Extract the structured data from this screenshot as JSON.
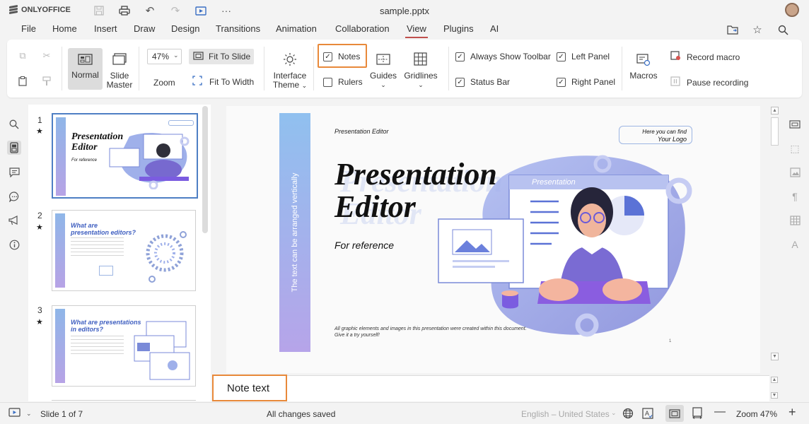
{
  "app": {
    "brand": "ONLYOFFICE",
    "file_title": "sample.pptx"
  },
  "menu": {
    "tabs": [
      "File",
      "Home",
      "Insert",
      "Draw",
      "Design",
      "Transitions",
      "Animation",
      "Collaboration",
      "View",
      "Plugins",
      "AI"
    ],
    "active": "View"
  },
  "toolbar": {
    "normal": "Normal",
    "slide_master_1": "Slide",
    "slide_master_2": "Master",
    "zoom_value": "47%",
    "zoom_label": "Zoom",
    "fit_to_slide": "Fit To Slide",
    "fit_to_width": "Fit To Width",
    "interface_theme_1": "Interface",
    "interface_theme_2": "Theme",
    "notes": "Notes",
    "rulers": "Rulers",
    "guides": "Guides",
    "gridlines": "Gridlines",
    "always_show_toolbar": "Always Show Toolbar",
    "status_bar": "Status Bar",
    "left_panel": "Left Panel",
    "right_panel": "Right Panel",
    "macros": "Macros",
    "record_macro": "Record macro",
    "pause_recording": "Pause recording",
    "checks": {
      "notes": true,
      "rulers": false,
      "always_show_toolbar": true,
      "status_bar": true,
      "left_panel": true,
      "right_panel": true
    }
  },
  "thumbnails": [
    {
      "num": "1",
      "title_1": "Presentation",
      "title_2": "Editor",
      "sub": "For reference"
    },
    {
      "num": "2",
      "title_1": "What are",
      "title_2": "presentation editors?"
    },
    {
      "num": "3",
      "title_1": "What are presentations",
      "title_2": "in editors?"
    }
  ],
  "slide": {
    "vertical_text": "The text can be arranged vertically",
    "top_label": "Presentation Editor",
    "title_1": "Presentation",
    "title_2": "Editor",
    "subtitle": "For reference",
    "logo_1": "Here you can find",
    "logo_2": "Your Logo",
    "window_label": "Presentation",
    "footer_1": "All graphic elements and images in this presentation were created within this document.",
    "footer_2": "Give it a try yourself!",
    "page_num": "1"
  },
  "notes": {
    "text": "Note text"
  },
  "status": {
    "slide_info": "Slide 1 of 7",
    "saved": "All changes saved",
    "language": "English – United States",
    "zoom": "Zoom 47%"
  },
  "colors": {
    "accent_tab": "#c0504d",
    "highlight": "#e8893a",
    "selection": "#4e7fc4"
  }
}
